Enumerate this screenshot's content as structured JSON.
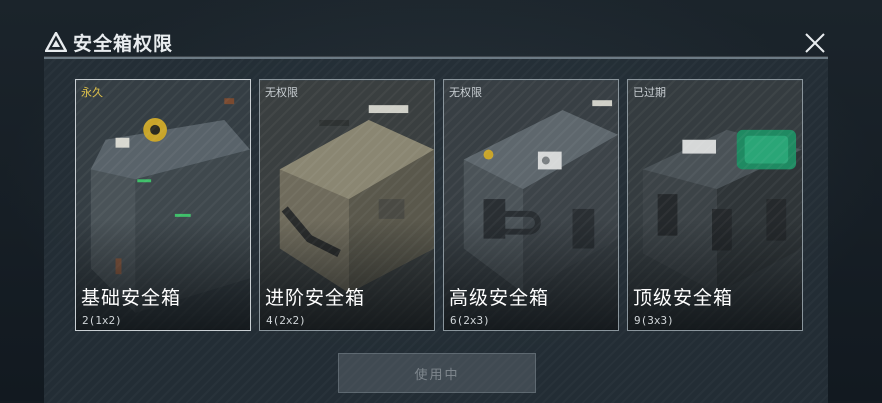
{
  "header": {
    "title": "安全箱权限"
  },
  "cards": [
    {
      "status": "永久",
      "name": "基础安全箱",
      "size": "2(1x2)"
    },
    {
      "status": "无权限",
      "name": "进阶安全箱",
      "size": "4(2x2)"
    },
    {
      "status": "无权限",
      "name": "高级安全箱",
      "size": "6(2x3)"
    },
    {
      "status": "已过期",
      "name": "顶级安全箱",
      "size": "9(3x3)"
    }
  ],
  "action": {
    "label": "使用中"
  }
}
